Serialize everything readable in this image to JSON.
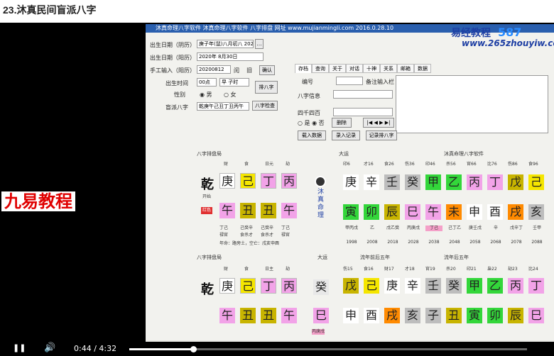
{
  "page_title": "23.沐真民间盲派八字",
  "brand": "九易教程",
  "watermark": {
    "site": "易经教程",
    "url": "www.265zhouyiw.com",
    "num": "587"
  },
  "app_title": "沐真命理八字软件  沐真命理八字软件 八字排盘 网址 www.mujianmingli.com 2016.0.28.10",
  "form": {
    "labels": [
      "出生日期（阴历）",
      "出生日期（阳历）",
      "手工输入（阳历）",
      "出生时间",
      "性别",
      "盲派八字"
    ],
    "lunar_value": "庚子年(鼠)八月初八 2020-08-20",
    "solar_value": "2020年 8月30日",
    "manual_value": "20200812",
    "manual_opt1": "闰",
    "manual_opt2": "旧",
    "confirm": "确认",
    "time_value": "00点",
    "time_select": "早 子时",
    "male": "男",
    "female": "女",
    "bazi_value": "乾庚午己丑丁丑丙午",
    "btn_paipan": "排八字",
    "btn_check": "八字检查"
  },
  "tabs": [
    "存档",
    "查询",
    "关于",
    "对话",
    "十神",
    "关系",
    "邮箱",
    "数据"
  ],
  "archive": {
    "code_label": "编号",
    "note_label": "备注输入栏",
    "info_label": "八字信息",
    "search_label": "四千四百",
    "opt_yes": "是",
    "opt_no": "否",
    "delete": "删除",
    "btn1": "载入数据",
    "btn2": "录入记录",
    "btn3": "记录排八字"
  },
  "top_chart": {
    "title": "八字排盘局",
    "gods": [
      "财",
      "食",
      "日元",
      "劫"
    ],
    "stems": [
      "庚",
      "己",
      "丁",
      "丙"
    ],
    "branches": [
      "午",
      "丑",
      "丑",
      "午"
    ],
    "hidden": [
      "丁己",
      "己癸辛",
      "己癸辛",
      "丁己"
    ],
    "hidden_gods": [
      "禄官",
      "食杀才",
      "食杀才",
      "禄官"
    ],
    "extra": "年命：路旁土，空亡：戌亥申酉",
    "qian": "乾",
    "kaishu": "开始",
    "hongshi": "红色"
  },
  "logo": "沐真命理",
  "dayun": {
    "label": "大运",
    "title": "沐真命理八字软件",
    "gods": [
      "印6",
      "才16",
      "食26",
      "伤36",
      "印46",
      "杀56",
      "官66",
      "比76",
      "伤86",
      "食96"
    ],
    "stems": [
      "庚",
      "辛",
      "壬",
      "癸",
      "甲",
      "乙",
      "丙",
      "丁",
      "戊",
      "己"
    ],
    "branches": [
      "寅",
      "卯",
      "辰",
      "巳",
      "午",
      "未",
      "申",
      "酉",
      "戌",
      "亥"
    ],
    "notes": [
      "甲丙戊",
      "乙",
      "戊乙癸",
      "丙庚戊",
      "丁己",
      "己丁乙",
      "庚壬戊",
      "辛",
      "戊辛丁",
      "壬甲"
    ],
    "years": [
      "1998",
      "2008",
      "2018",
      "2028",
      "2038",
      "2048",
      "2058",
      "2068",
      "2078",
      "2088"
    ]
  },
  "bottom": {
    "title": "八字排盘局",
    "flow_title": "流年前后五年",
    "flow_title2": "流年后五年",
    "gods": [
      "财",
      "食",
      "日主",
      "劫"
    ],
    "stems": [
      "庚",
      "己",
      "丁",
      "丙"
    ],
    "branches": [
      "午",
      "丑",
      "丑",
      "午"
    ],
    "qian": "乾",
    "yun": "大运",
    "yun_stem": "癸",
    "yun_branch": "巳",
    "yun_note": "丙庚戊",
    "yun_year": "2028"
  },
  "flow": {
    "gods": [
      "伤15",
      "食16",
      "财17",
      "才18",
      "官19",
      "杀20",
      "印21",
      "枭22",
      "劫23",
      "比24"
    ],
    "stems": [
      "戊",
      "己",
      "庚",
      "辛",
      "壬",
      "癸",
      "甲",
      "乙",
      "丙",
      "丁"
    ],
    "branches": [
      "申",
      "酉",
      "戌",
      "亥",
      "子",
      "丑",
      "寅",
      "卯",
      "辰",
      "巳"
    ],
    "years": [
      "2023",
      "2024",
      "2025",
      "2026",
      "2027",
      "2028",
      "2029",
      "2030",
      "2031",
      "2032"
    ]
  },
  "player": {
    "time": "0:44 / 4:32",
    "progress": 0.16
  }
}
